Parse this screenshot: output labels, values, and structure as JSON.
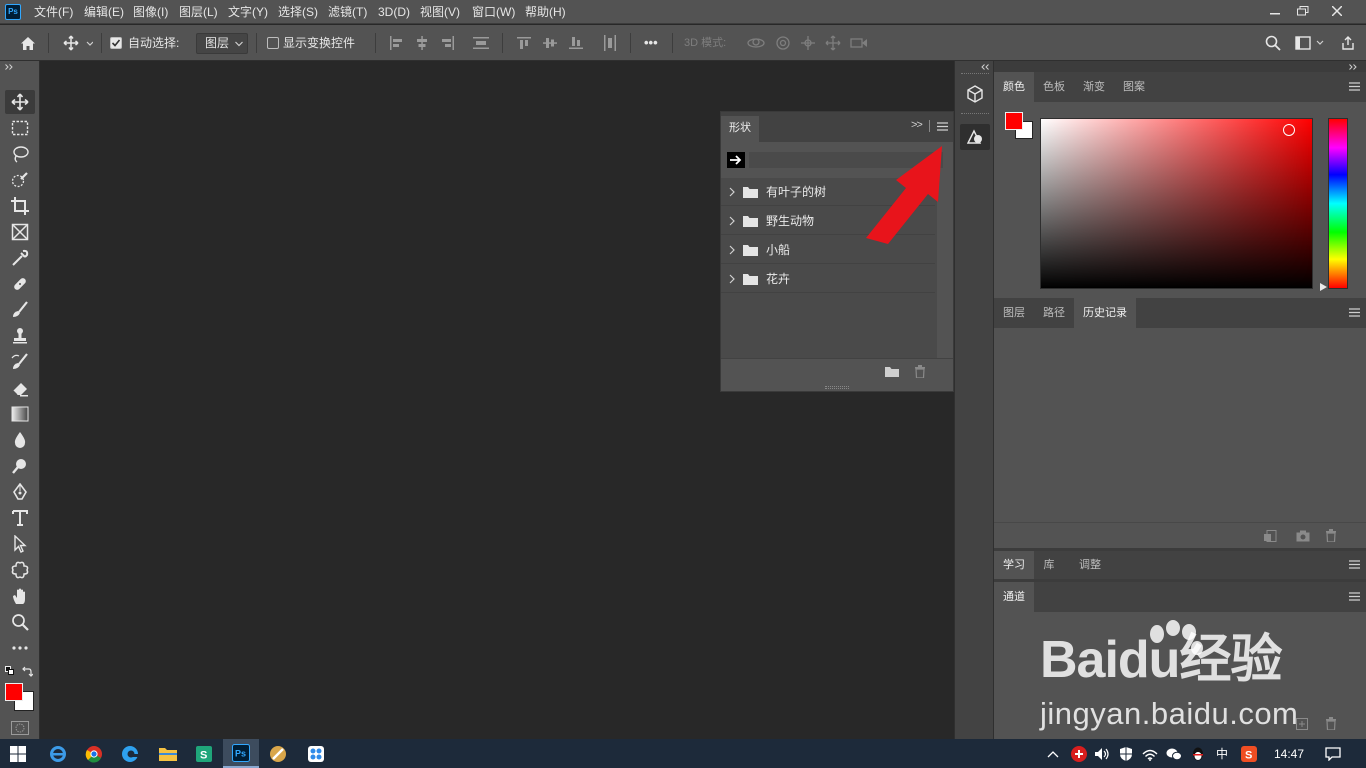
{
  "app": {
    "logo_text": "Ps"
  },
  "menubar": {
    "items": [
      {
        "label": "文件(F)"
      },
      {
        "label": "编辑(E)"
      },
      {
        "label": "图像(I)"
      },
      {
        "label": "图层(L)"
      },
      {
        "label": "文字(Y)"
      },
      {
        "label": "选择(S)"
      },
      {
        "label": "滤镜(T)"
      },
      {
        "label": "3D(D)"
      },
      {
        "label": "视图(V)"
      },
      {
        "label": "窗口(W)"
      },
      {
        "label": "帮助(H)"
      }
    ]
  },
  "optionsbar": {
    "auto_select_label": "自动选择:",
    "auto_select_checked": true,
    "auto_select_target": "图层",
    "show_transform_label": "显示变换控件",
    "show_transform_checked": false,
    "mode_3d_label": "3D 模式:",
    "more_label": "•••"
  },
  "shapes_panel": {
    "title": "形状",
    "collapse_label": ">>",
    "groups": [
      {
        "label": "有叶子的树"
      },
      {
        "label": "野生动物"
      },
      {
        "label": "小船"
      },
      {
        "label": "花卉"
      }
    ]
  },
  "color_panel": {
    "tabs": [
      {
        "label": "颜色"
      },
      {
        "label": "色板"
      },
      {
        "label": "渐变"
      },
      {
        "label": "图案"
      }
    ],
    "active_tab": "颜色",
    "foreground": "#ff0000",
    "background": "#ffffff"
  },
  "history_panel": {
    "tabs": [
      {
        "label": "图层"
      },
      {
        "label": "路径"
      },
      {
        "label": "历史记录"
      }
    ],
    "active_tab": "历史记录"
  },
  "learn_panel": {
    "tabs": [
      {
        "label": "学习"
      },
      {
        "label": "库"
      },
      {
        "label": "调整"
      }
    ],
    "active_tab": "学习"
  },
  "channels_panel": {
    "tabs": [
      {
        "label": "通道"
      }
    ],
    "active_tab": "通道"
  },
  "taskbar": {
    "ime_label": "中",
    "clock": "14:47"
  },
  "watermark": {
    "logo": "Baidu经验",
    "url": "jingyan.baidu.com"
  },
  "colors": {
    "ui_panel": "#535353",
    "ui_dark": "#282828",
    "accent_red": "#e8141b",
    "taskbar": "#1d2a3a"
  }
}
